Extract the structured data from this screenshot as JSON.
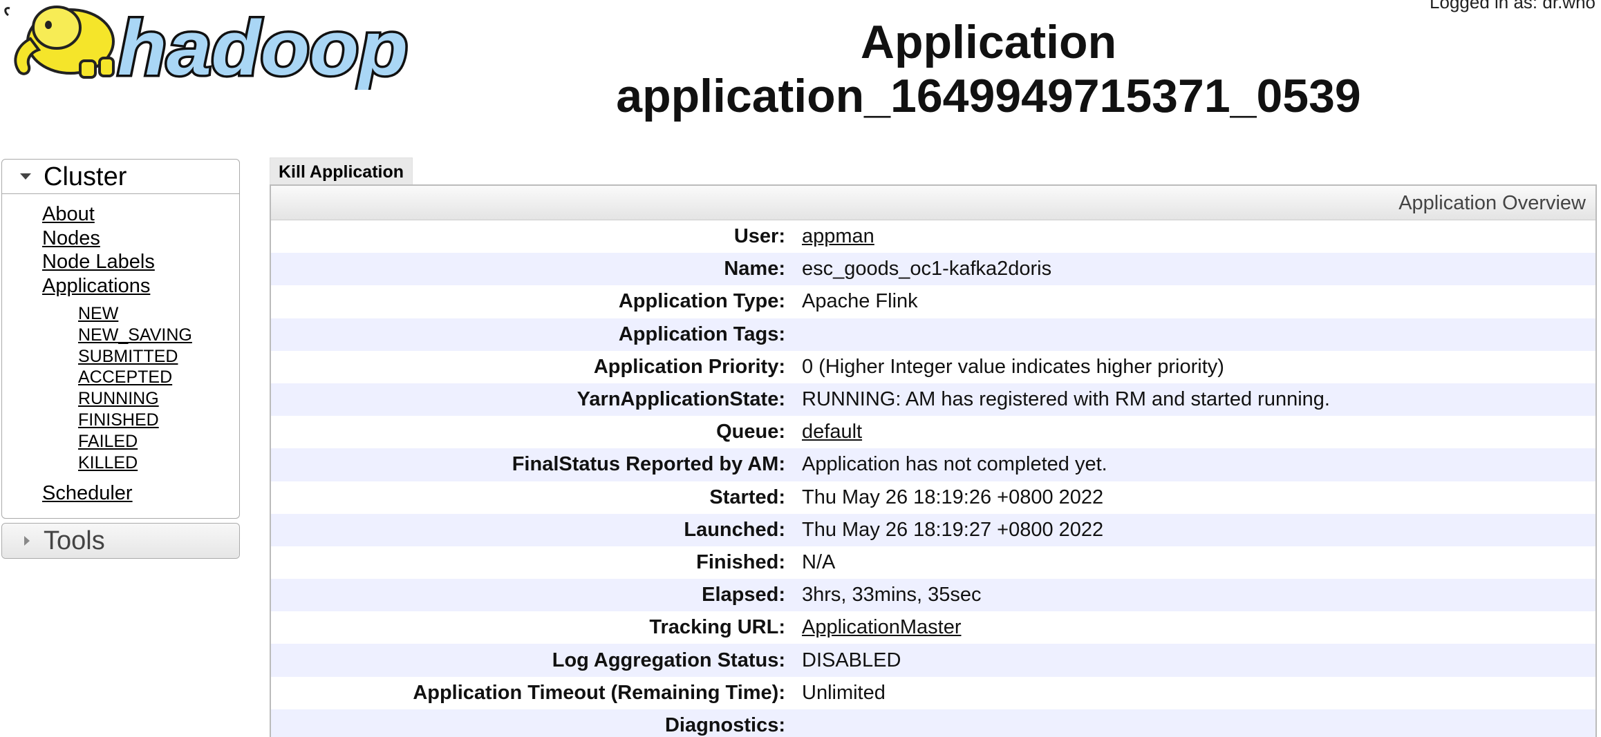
{
  "header": {
    "logo_text": "hadoop",
    "login_status": "Logged in as: dr.who",
    "title_line1": "Application",
    "title_line2": "application_1649949715371_0539"
  },
  "sidebar": {
    "cluster": {
      "label": "Cluster",
      "links": [
        "About",
        "Nodes",
        "Node Labels",
        "Applications"
      ],
      "app_states": [
        "NEW",
        "NEW_SAVING",
        "SUBMITTED",
        "ACCEPTED",
        "RUNNING",
        "FINISHED",
        "FAILED",
        "KILLED"
      ],
      "scheduler": "Scheduler"
    },
    "tools": {
      "label": "Tools"
    }
  },
  "main": {
    "kill_button": "Kill Application",
    "overview_title": "Application Overview",
    "rows": [
      {
        "label": "User:",
        "value": "appman",
        "link": true
      },
      {
        "label": "Name:",
        "value": "esc_goods_oc1-kafka2doris",
        "link": false
      },
      {
        "label": "Application Type:",
        "value": "Apache Flink",
        "link": false
      },
      {
        "label": "Application Tags:",
        "value": "",
        "link": false
      },
      {
        "label": "Application Priority:",
        "value": "0 (Higher Integer value indicates higher priority)",
        "link": false
      },
      {
        "label": "YarnApplicationState:",
        "value": "RUNNING: AM has registered with RM and started running.",
        "link": false
      },
      {
        "label": "Queue:",
        "value": "default",
        "link": true
      },
      {
        "label": "FinalStatus Reported by AM:",
        "value": "Application has not completed yet.",
        "link": false
      },
      {
        "label": "Started:",
        "value": "Thu May 26 18:19:26 +0800 2022",
        "link": false
      },
      {
        "label": "Launched:",
        "value": "Thu May 26 18:19:27 +0800 2022",
        "link": false
      },
      {
        "label": "Finished:",
        "value": "N/A",
        "link": false
      },
      {
        "label": "Elapsed:",
        "value": "3hrs, 33mins, 35sec",
        "link": false
      },
      {
        "label": "Tracking URL:",
        "value": "ApplicationMaster",
        "link": true
      },
      {
        "label": "Log Aggregation Status:",
        "value": "DISABLED",
        "link": false
      },
      {
        "label": "Application Timeout (Remaining Time):",
        "value": "Unlimited",
        "link": false
      },
      {
        "label": "Diagnostics:",
        "value": "",
        "link": false
      }
    ]
  },
  "colors": {
    "logo_fill": "#a9d6f5",
    "elephant": "#f5e52a",
    "row_alt": "#eef0ff"
  }
}
